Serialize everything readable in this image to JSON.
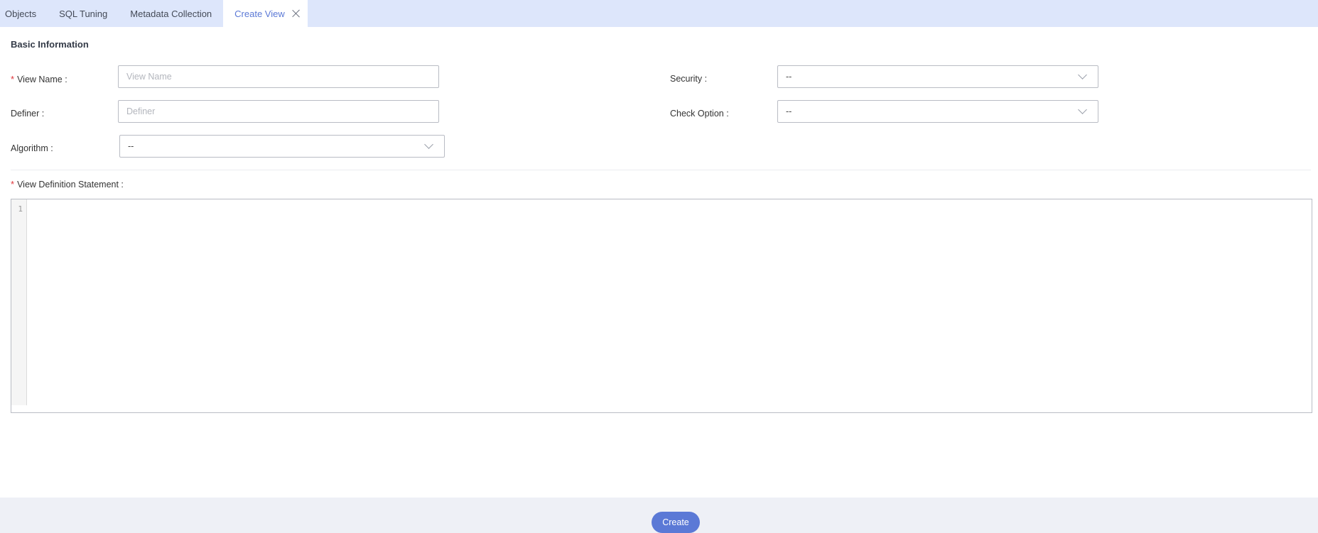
{
  "tabs": [
    {
      "label": "Objects"
    },
    {
      "label": "SQL Tuning"
    },
    {
      "label": "Metadata Collection"
    },
    {
      "label": "Create View"
    }
  ],
  "form": {
    "section_title": "Basic Information",
    "view_name_label": "View Name :",
    "view_name_placeholder": "View Name",
    "definer_label": "Definer :",
    "definer_placeholder": "Definer",
    "algorithm_label": "Algorithm :",
    "algorithm_value": "--",
    "security_label": "Security :",
    "security_value": "--",
    "check_option_label": "Check Option :",
    "check_option_value": "--",
    "statement_label": "View Definition Statement :",
    "required_mark": "*"
  },
  "editor": {
    "line_number": "1"
  },
  "footer": {
    "create_label": "Create"
  },
  "colors": {
    "accent": "#5b79d6",
    "tabbar_bg": "#dde6fb",
    "required": "#e0353b",
    "footer_bg": "#eef0f6"
  }
}
